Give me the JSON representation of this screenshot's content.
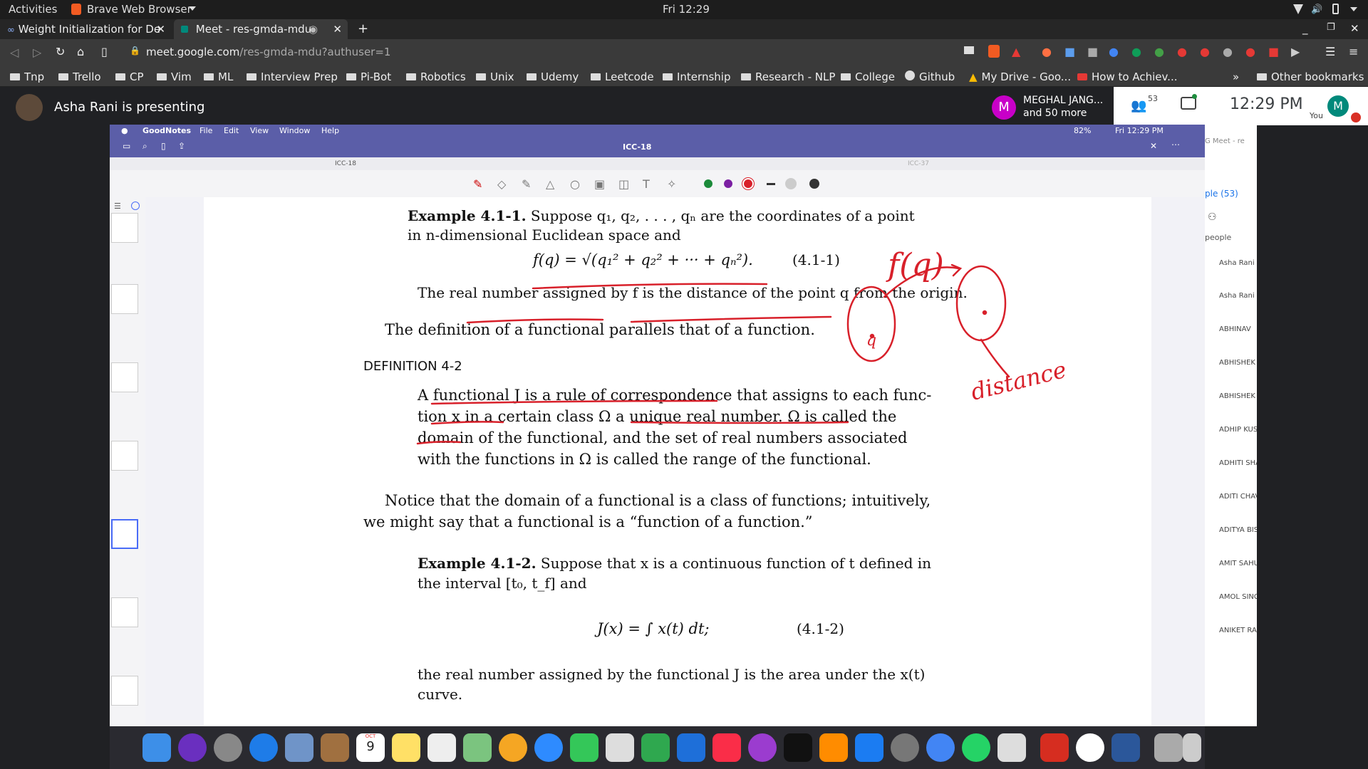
{
  "system_bar": {
    "activities": "Activities",
    "browser": "Brave Web Browser",
    "clock": "Fri 12:29"
  },
  "tabs": [
    {
      "title": "Weight Initialization for De"
    },
    {
      "title": "Meet - res-gmda-mdu"
    }
  ],
  "address": {
    "domain": "meet.google.com",
    "path": "/res-gmda-mdu?authuser=1"
  },
  "bookmarks": [
    "Tnp",
    "Trello",
    "CP",
    "Vim",
    "ML",
    "Interview Prep",
    "Pi-Bot",
    "Robotics",
    "Unix",
    "Udemy",
    "Leetcode",
    "Internship",
    "Research - NLP",
    "College",
    "Github",
    "My Drive - Goo...",
    "How to Achiev...",
    "Other bookmarks"
  ],
  "meet": {
    "presenting": "Asha Rani is presenting",
    "participant_name": "MEGHAL JANG...",
    "participant_more": "and 50 more",
    "participant_count": "53",
    "time": "12:29 PM",
    "you_label": "You",
    "avatar_letter": "M"
  },
  "mac": {
    "app": "GoodNotes",
    "menus": [
      "File",
      "Edit",
      "View",
      "Window",
      "Help"
    ],
    "battery": "82%",
    "datetime": "Fri 12:29 PM",
    "doc_title": "ICC-18",
    "tab_left": "ICC-18",
    "tab_right": "ICC-37"
  },
  "doc": {
    "ex1_title": "Example 4.1-1.",
    "ex1_text": "Suppose q₁, q₂, . . . , qₙ are the coordinates of a point",
    "ex1_text2": "in n-dimensional Euclidean space and",
    "eq1": "f(q) = √(q₁² + q₂² + ··· + qₙ²).",
    "eq1_num": "(4.1-1)",
    "ex1_result": "The real number assigned by f is the distance of the point q from the origin.",
    "def_intro": "The definition of a functional parallels that of a function.",
    "def_heading": "DEFINITION 4-2",
    "def_l1": "A functional J is a rule of correspondence that assigns to each func-",
    "def_l2": "tion x in a certain class Ω a unique real number. Ω is called the",
    "def_l3": "domain of the functional, and the set of real numbers associated",
    "def_l4": "with the functions in Ω is called the range of the functional.",
    "notice_l1": "Notice that the domain of a functional is a class of functions; intuitively,",
    "notice_l2": "we might say that a functional is a “function of a function.”",
    "ex2_title": "Example 4.1-2.",
    "ex2_text": "Suppose that x is a continuous function of t defined in",
    "ex2_text2": "the interval [t₀, t_f] and",
    "eq2": "J(x) = ∫ x(t) dt;",
    "eq2_num": "(4.1-2)",
    "ex2_result1": "the real number assigned by the functional J is the area under the x(t)",
    "ex2_result2": "curve."
  },
  "annotations": {
    "fq": "f(q)",
    "q": "q",
    "distance": "distance"
  },
  "people_panel": {
    "header": "ple (53)",
    "people_label": "people",
    "names": [
      "Asha Rani (",
      "Asha Rani (",
      "ABHINAV",
      "ABHISHEK",
      "ABHISHEK",
      "ADHIP KUS",
      "ADHITI SHA",
      "ADITI CHAV",
      "ADITYA BIS",
      "AMIT SAHU",
      "AMOL SING",
      "ANIKET RA"
    ]
  },
  "dock_calendar": {
    "month": "OCT",
    "day": "9"
  },
  "colors": {
    "goodnotes_bar": "#5b5ea8",
    "annotation": "#d8202a",
    "meet_bg": "#202124"
  }
}
